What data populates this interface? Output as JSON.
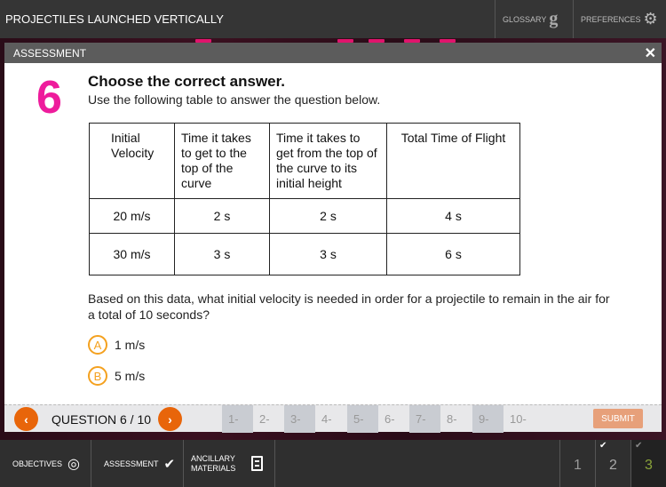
{
  "header": {
    "title": "PROJECTILES LAUNCHED VERTICALLY",
    "glossary": "GLOSSARY",
    "preferences": "PREFERENCES"
  },
  "modal": {
    "title": "ASSESSMENT",
    "close": "✕"
  },
  "question": {
    "number": "6",
    "heading": "Choose the correct answer.",
    "instruction": "Use the following table to answer the question below.",
    "table": {
      "headers": [
        "Initial Velocity",
        "Time it takes to get to the top of the curve",
        "Time it takes to get from the top of the curve to its initial height",
        "Total Time of Flight"
      ],
      "rows": [
        [
          "20 m/s",
          "2 s",
          "2 s",
          "4 s"
        ],
        [
          "30 m/s",
          "3 s",
          "3 s",
          "6 s"
        ]
      ]
    },
    "text": "Based on this data, what initial velocity is needed in order for a projectile to remain in the air for a total of 10 seconds?",
    "options": [
      {
        "letter": "A",
        "text": "1 m/s"
      },
      {
        "letter": "B",
        "text": "5 m/s"
      }
    ]
  },
  "nav": {
    "label": "QUESTION 6 / 10",
    "items": [
      "1-",
      "2-",
      "3-",
      "4-",
      "5-",
      "6-",
      "7-",
      "8-",
      "9-",
      "10-"
    ],
    "submit": "SUBMIT"
  },
  "bottom": {
    "objectives": "OBJECTIVES",
    "assessment": "ASSESSMENT",
    "ancillary_1": "ANCILLARY",
    "ancillary_2": "MATERIALS",
    "pages": [
      "1",
      "2",
      "3"
    ]
  },
  "colors": {
    "accent": "#e8650a",
    "option": "#f4a11f",
    "question_number": "#ee1c9c",
    "active_page": "#8aa33a"
  }
}
